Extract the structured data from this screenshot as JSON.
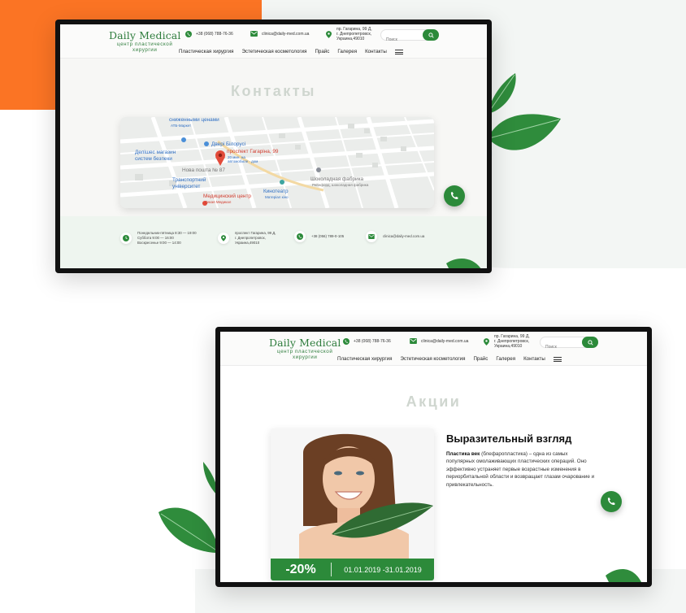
{
  "colors": {
    "accent_green": "#2c8a3a",
    "brand_orange": "#fb7424",
    "logo_green": "#2f7d3d",
    "title_gray": "#cfd6cf"
  },
  "header": {
    "logo_main": "Daily Medical",
    "logo_sub_line1": "центр пластической",
    "logo_sub_line2": "хирургии",
    "phone": "+38 (068) 788-76-36",
    "email": "clinica@daily-med.com.ua",
    "address_line1": "пр. Гагарина, 99 Д,",
    "address_line2": "г. Днепропетровск,",
    "address_line3": "Украина,49010",
    "search_placeholder": "Поиск",
    "nav": [
      "Пластическая хирургия",
      "Эстетическая косметология",
      "Прайс",
      "Галерея",
      "Контакты"
    ]
  },
  "contacts_page": {
    "title": "Контакты",
    "map_labels": {
      "label1": "сниженными ценами",
      "label2": "АТБ-Маркет",
      "label3": "Двері Білорусі",
      "label4": "проспект Гагаріна, 99",
      "label5a": "20 мин. на",
      "label5b": "автомобиле · дом",
      "label6a": "Делішес магазин",
      "label6b": "систем безпеки",
      "label7": "Нова пошта № 87",
      "label8": "Шоколадная фабрика",
      "label9": "Рейнфорд, шоколадная фабрика",
      "label10a": "Транспортний",
      "label10b": "університет",
      "label11": "Кинотеатр",
      "label12": "Матеріал кіно",
      "label13": "Медицинский центр",
      "label14": "Дикая Медикал"
    },
    "info": {
      "hours_line1": "Понедельник-пятница 8:30 — 19:00",
      "hours_line2": "Суббота 9:00 — 16:00",
      "hours_line3": "Воскресенье 9:00 — 14:00",
      "address_line1": "проспект Гагарина, 99 Д,",
      "address_line2": "г. Днепропетровск,",
      "address_line3": "Украина,49010",
      "phone": "+38 (056) 789-0-105",
      "email": "clinica@daily-med.com.ua"
    }
  },
  "promo_page": {
    "title": "Акции",
    "promo_title": "Выразительный взгляд",
    "promo_bold": "Пластика век",
    "promo_text": " (блефаропластика) – одна из самых популярных омолаживающих пластических операций. Оно эффективно устраняет первые возрастные изменения в периорбитальной области и возвращает глазам очарование и привлекательность.",
    "discount": "-20%",
    "dates": "01.01.2019 -31.01.2019"
  }
}
